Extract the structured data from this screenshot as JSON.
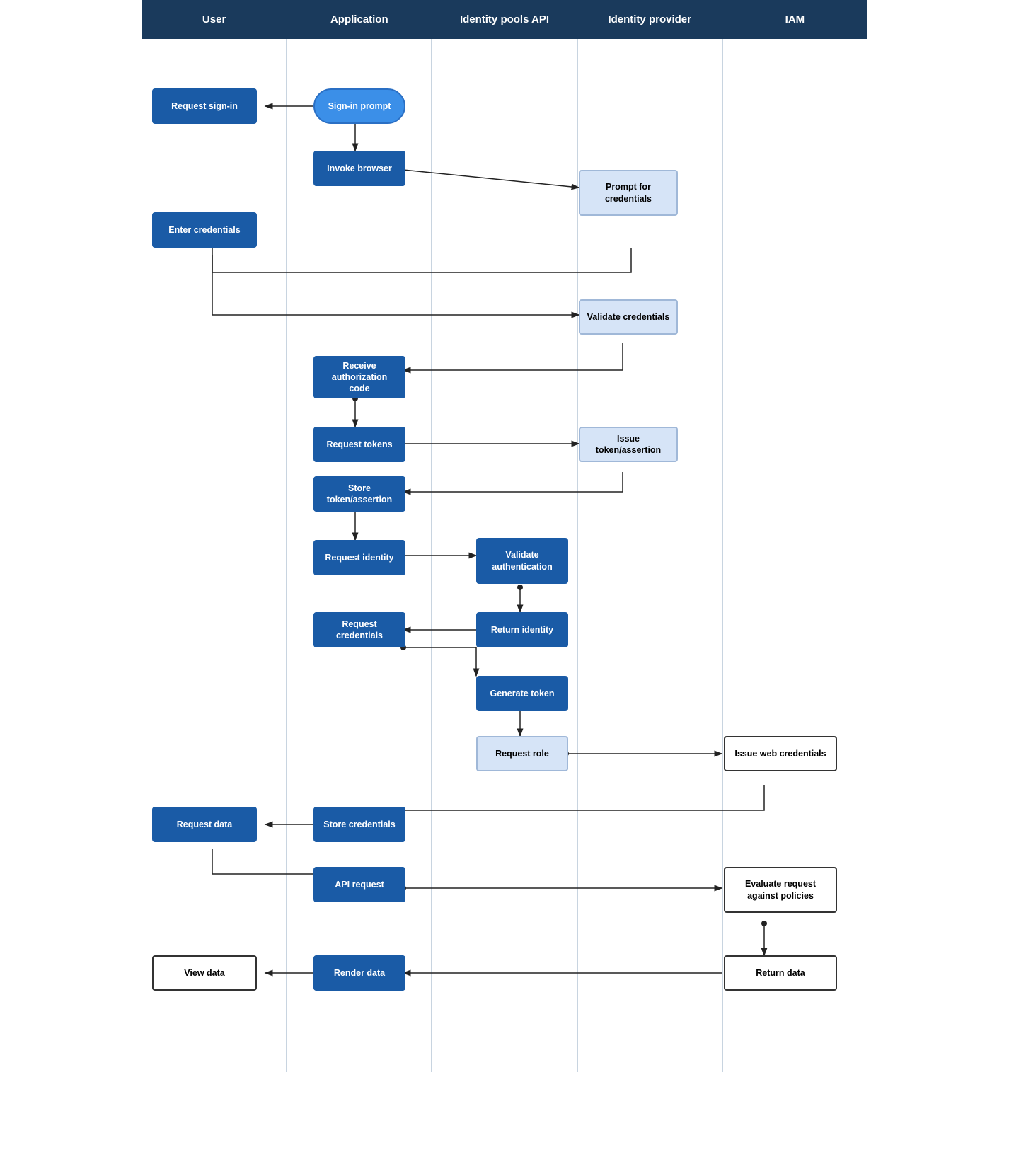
{
  "header": {
    "columns": [
      "User",
      "Application",
      "Identity pools API",
      "Identity provider",
      "IAM"
    ]
  },
  "boxes": {
    "request_signin": "Request sign-in",
    "signin_prompt": "Sign-in prompt",
    "invoke_browser": "Invoke browser",
    "prompt_credentials": "Prompt for\ncredentials",
    "enter_credentials": "Enter credentials",
    "validate_credentials": "Validate credentials",
    "receive_auth_code": "Receive authorization\ncode",
    "request_tokens": "Request tokens",
    "issue_token_assertion": "Issue token/assertion",
    "store_token_assertion": "Store token/assertion",
    "request_identity": "Request identity",
    "validate_authentication": "Validate\nauthentication",
    "request_credentials": "Request credentials",
    "return_identity": "Return identity",
    "generate_token": "Generate token",
    "request_role": "Request role",
    "issue_web_credentials": "Issue web credentials",
    "store_credentials": "Store credentials",
    "request_data": "Request data",
    "api_request": "API request",
    "evaluate_request": "Evaluate request\nagainst policies",
    "render_data": "Render data",
    "return_data": "Return data",
    "view_data": "View data"
  }
}
